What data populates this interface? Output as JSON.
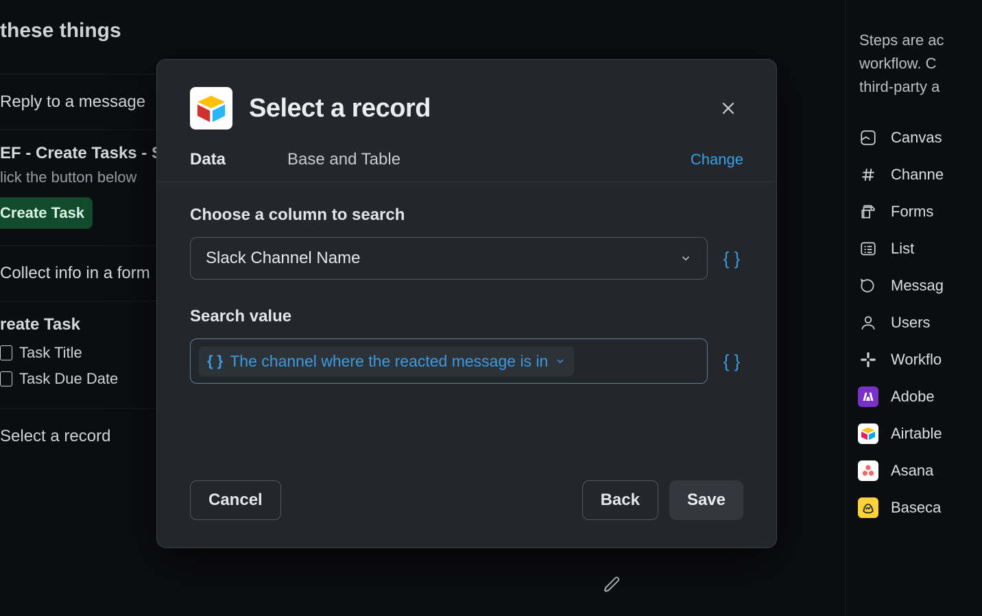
{
  "background": {
    "heading": "these things",
    "row_reply": "Reply to a message",
    "row_ef_title": "EF - Create Tasks - S",
    "row_ef_sub": "lick the button below",
    "create_task_btn": "Create Task",
    "row_form": "Collect info in a form",
    "create_task_h": "reate Task",
    "task_title": "Task Title",
    "task_due": "Task Due Date",
    "select_record": "Select a record"
  },
  "sidebar": {
    "intro_line1": "Steps are ac",
    "intro_line2": "workflow. C",
    "intro_line3": "third-party a",
    "items": [
      {
        "label": "Canvas",
        "icon": "canvas"
      },
      {
        "label": "Channe",
        "icon": "hash"
      },
      {
        "label": "Forms",
        "icon": "forms"
      },
      {
        "label": "List",
        "icon": "list"
      },
      {
        "label": "Messag",
        "icon": "message"
      },
      {
        "label": "Users",
        "icon": "user"
      },
      {
        "label": "Workflo",
        "icon": "slack"
      },
      {
        "label": "Adobe",
        "icon": "adobe",
        "app": true
      },
      {
        "label": "Airtable",
        "icon": "airtable",
        "app": true
      },
      {
        "label": "Asana",
        "icon": "asana",
        "app": true
      },
      {
        "label": "Baseca",
        "icon": "basecamp",
        "app": true
      }
    ]
  },
  "modal": {
    "title": "Select a record",
    "tabs": {
      "data": "Data",
      "base": "Base and Table"
    },
    "change": "Change",
    "column_label": "Choose a column to search",
    "column_value": "Slack Channel Name",
    "search_label": "Search value",
    "search_chip": "The channel where the reacted message is in",
    "buttons": {
      "cancel": "Cancel",
      "back": "Back",
      "save": "Save"
    }
  }
}
